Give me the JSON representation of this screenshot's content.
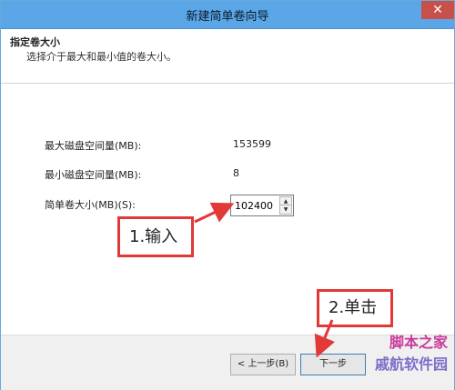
{
  "window": {
    "title": "新建简单卷向导",
    "close_label": "✕"
  },
  "header": {
    "title": "指定卷大小",
    "subtitle": "选择介于最大和最小值的卷大小。"
  },
  "content": {
    "max_label": "最大磁盘空间量(MB):",
    "max_value": "153599",
    "min_label": "最小磁盘空间量(MB):",
    "min_value": "8",
    "size_label": "简单卷大小(MB)(S):",
    "size_value": "102400"
  },
  "footer": {
    "back_label": "< 上一步(B)",
    "next_label": "下一步"
  },
  "annotations": {
    "step1": "1.输入",
    "step2": "2.单击"
  },
  "watermark": {
    "line1": "脚本之家",
    "line2": "戚航软件园"
  },
  "colors": {
    "titlebar": "#5aa6e6",
    "callout_border": "#e23838",
    "arrow": "#e23838"
  }
}
